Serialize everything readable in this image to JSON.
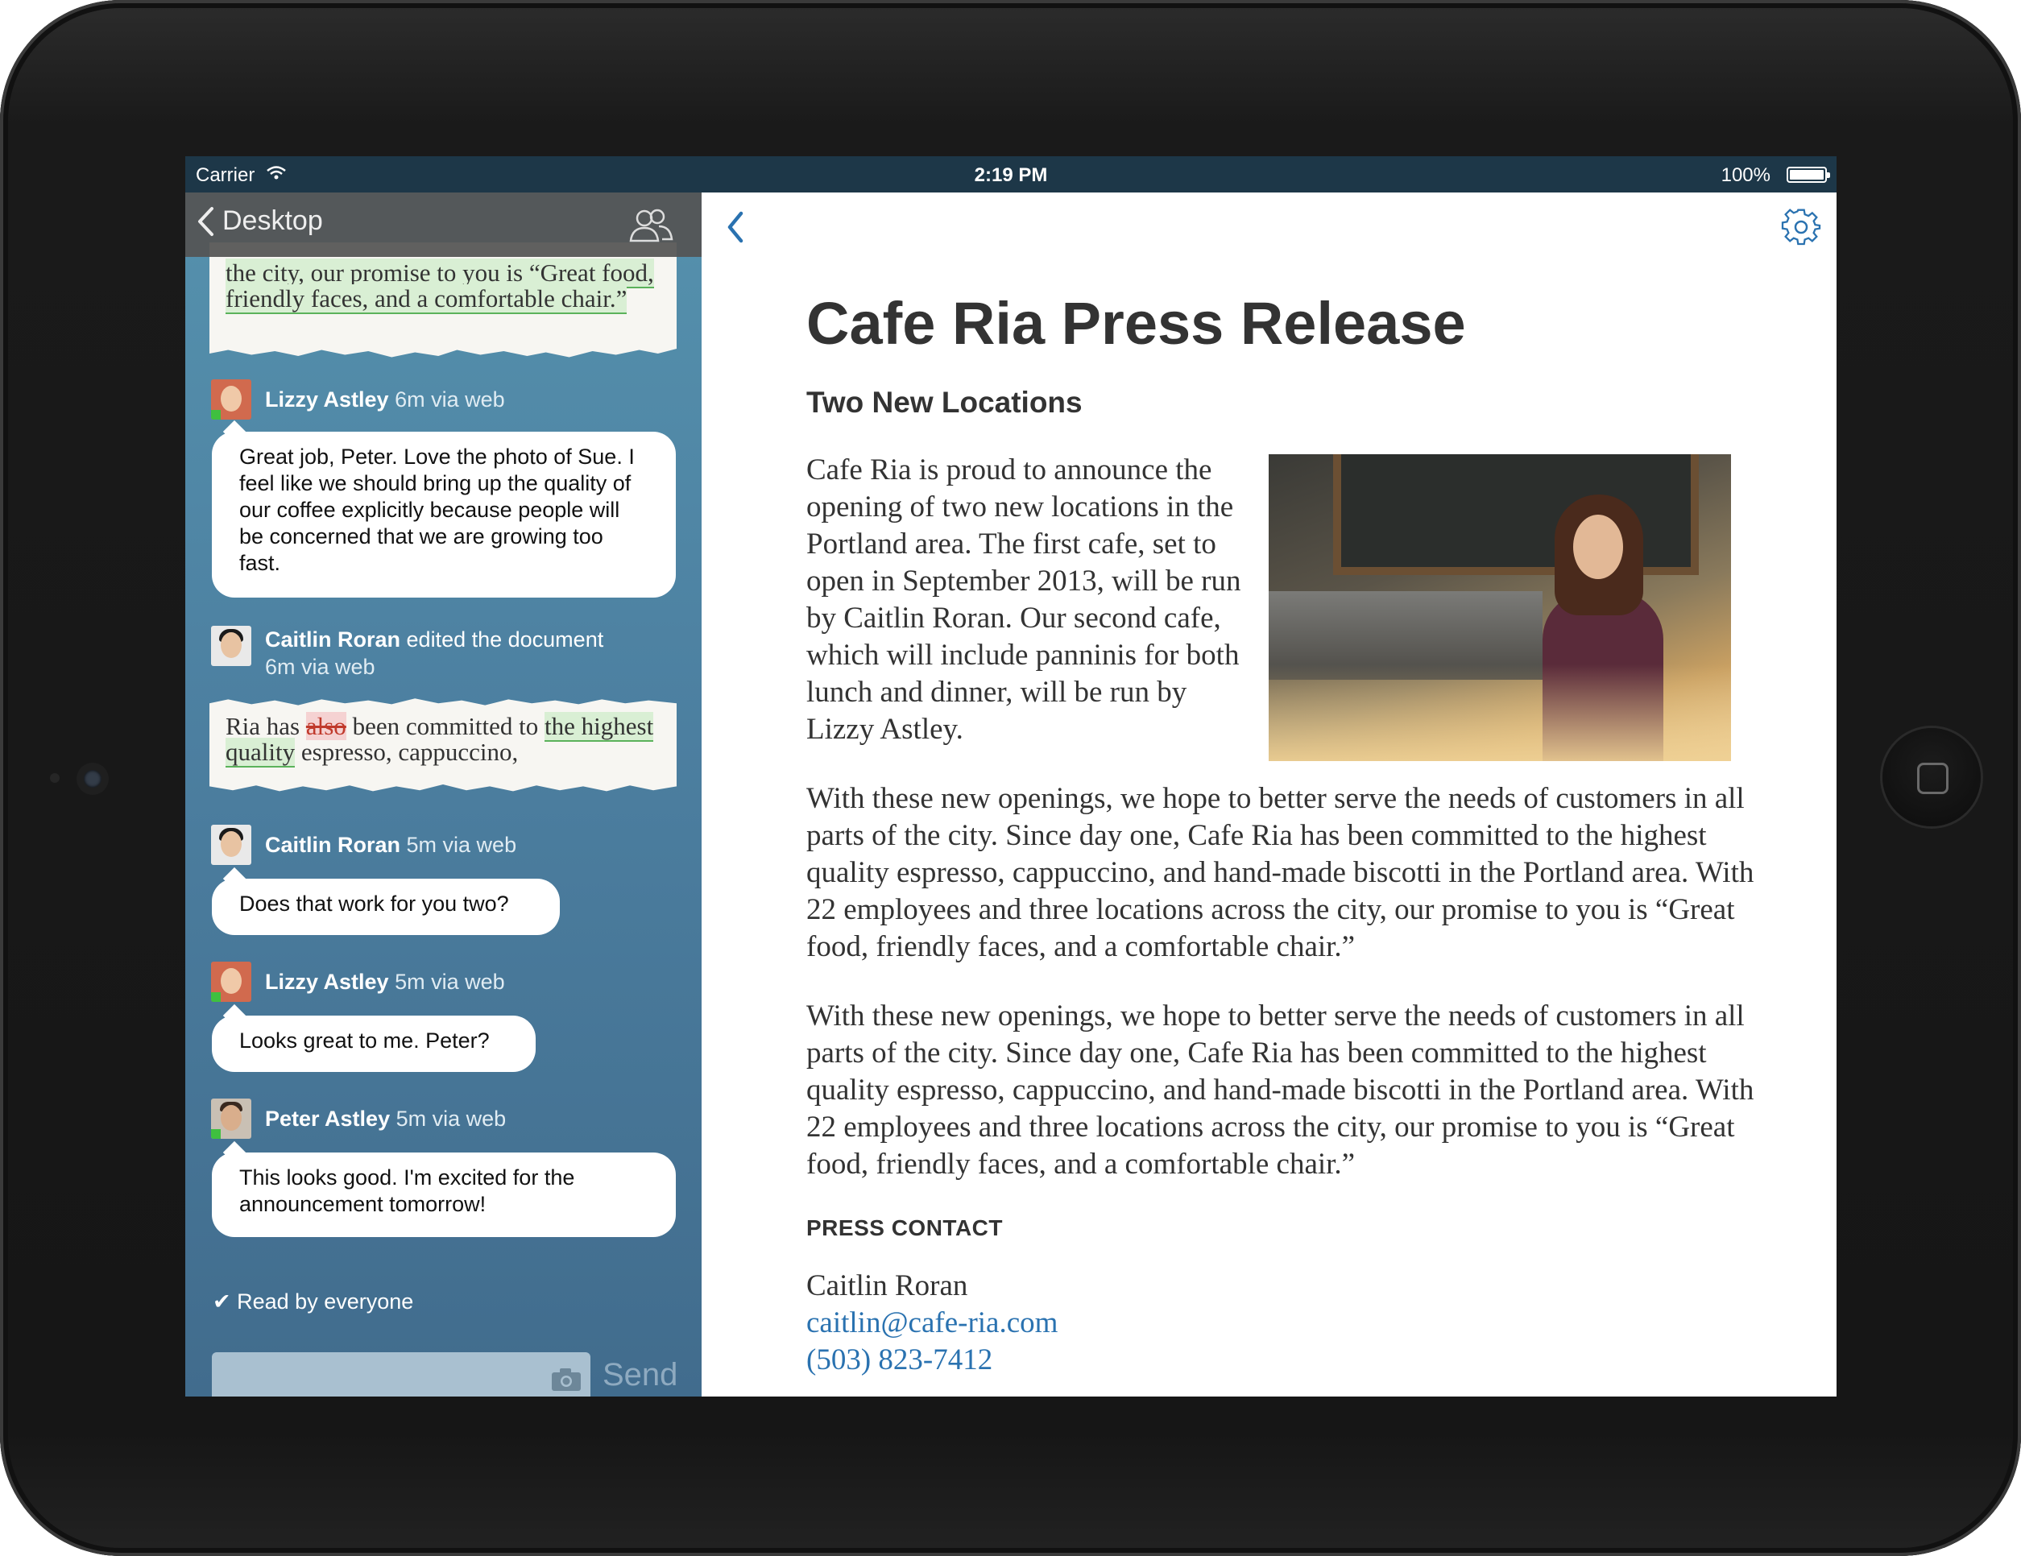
{
  "status_bar": {
    "carrier": "Carrier",
    "time": "2:19 PM",
    "battery": "100%"
  },
  "sidebar": {
    "back_label": "Desktop",
    "snippet_top": {
      "text": "the city, our promise to you is “Great food, friendly faces, and a comfortable chair.”"
    },
    "messages": [
      {
        "name": "Lizzy Astley",
        "meta": "6m via web",
        "text": "Great job, Peter. Love the photo of Sue. I feel like we should bring up the quality of our coffee explicitly because people will be concerned that we are growing too fast."
      },
      {
        "name": "Caitlin Roran",
        "action": "edited the document",
        "meta": "6m via web"
      },
      {
        "name": "Caitlin Roran",
        "meta": "5m via web",
        "text": "Does that work for you two?"
      },
      {
        "name": "Lizzy Astley",
        "meta": "5m via web",
        "text": "Looks great to me. Peter?"
      },
      {
        "name": "Peter Astley",
        "meta": "5m via web",
        "text": "This looks good. I'm excited for the announcement tomorrow!"
      }
    ],
    "edit_snippet": {
      "before": "Ria has ",
      "deleted": "also",
      "middle": " been committed to ",
      "inserted": "the highest quality",
      "after": " espresso, cappuccino,"
    },
    "read_receipt": "✔ Read by everyone",
    "send_label": "Send"
  },
  "document": {
    "title": "Cafe Ria Press Release",
    "subtitle": "Two New Locations",
    "paragraph_1": "Cafe Ria is proud to announce the opening of two new locations in the Portland area. The first cafe, set to open in September 2013, will be run by Caitlin Roran. Our second cafe, which will include panninis for both lunch and dinner, will be run by Lizzy Astley.",
    "paragraph_2": "With these new openings, we hope to better serve the needs of customers in all parts of the city. Since day one, Cafe Ria has been committed to the highest quality espresso, cappuccino, and hand-made biscotti in the Portland area. With 22 employees and three locations across the city, our promise to you is “Great food, friendly faces, and a comfortable chair.”",
    "paragraph_3": "With these new openings, we hope to better serve the needs of customers in all parts of the city. Since day one, Cafe Ria has been committed to the highest quality espresso, cappuccino, and hand-made biscotti in the Portland area. With 22 employees and three locations across the city, our promise to you is “Great food, friendly faces, and a comfortable chair.”",
    "press_heading": "PRESS CONTACT",
    "contact_name": "Caitlin Roran",
    "contact_email": "caitlin@cafe-ria.com",
    "contact_phone": "(503) 823-7412"
  },
  "colors": {
    "accent": "#2a72b0",
    "sidebar_top": "#5591ad",
    "sidebar_bottom": "#416c8d",
    "status_bar": "#1d3748"
  }
}
